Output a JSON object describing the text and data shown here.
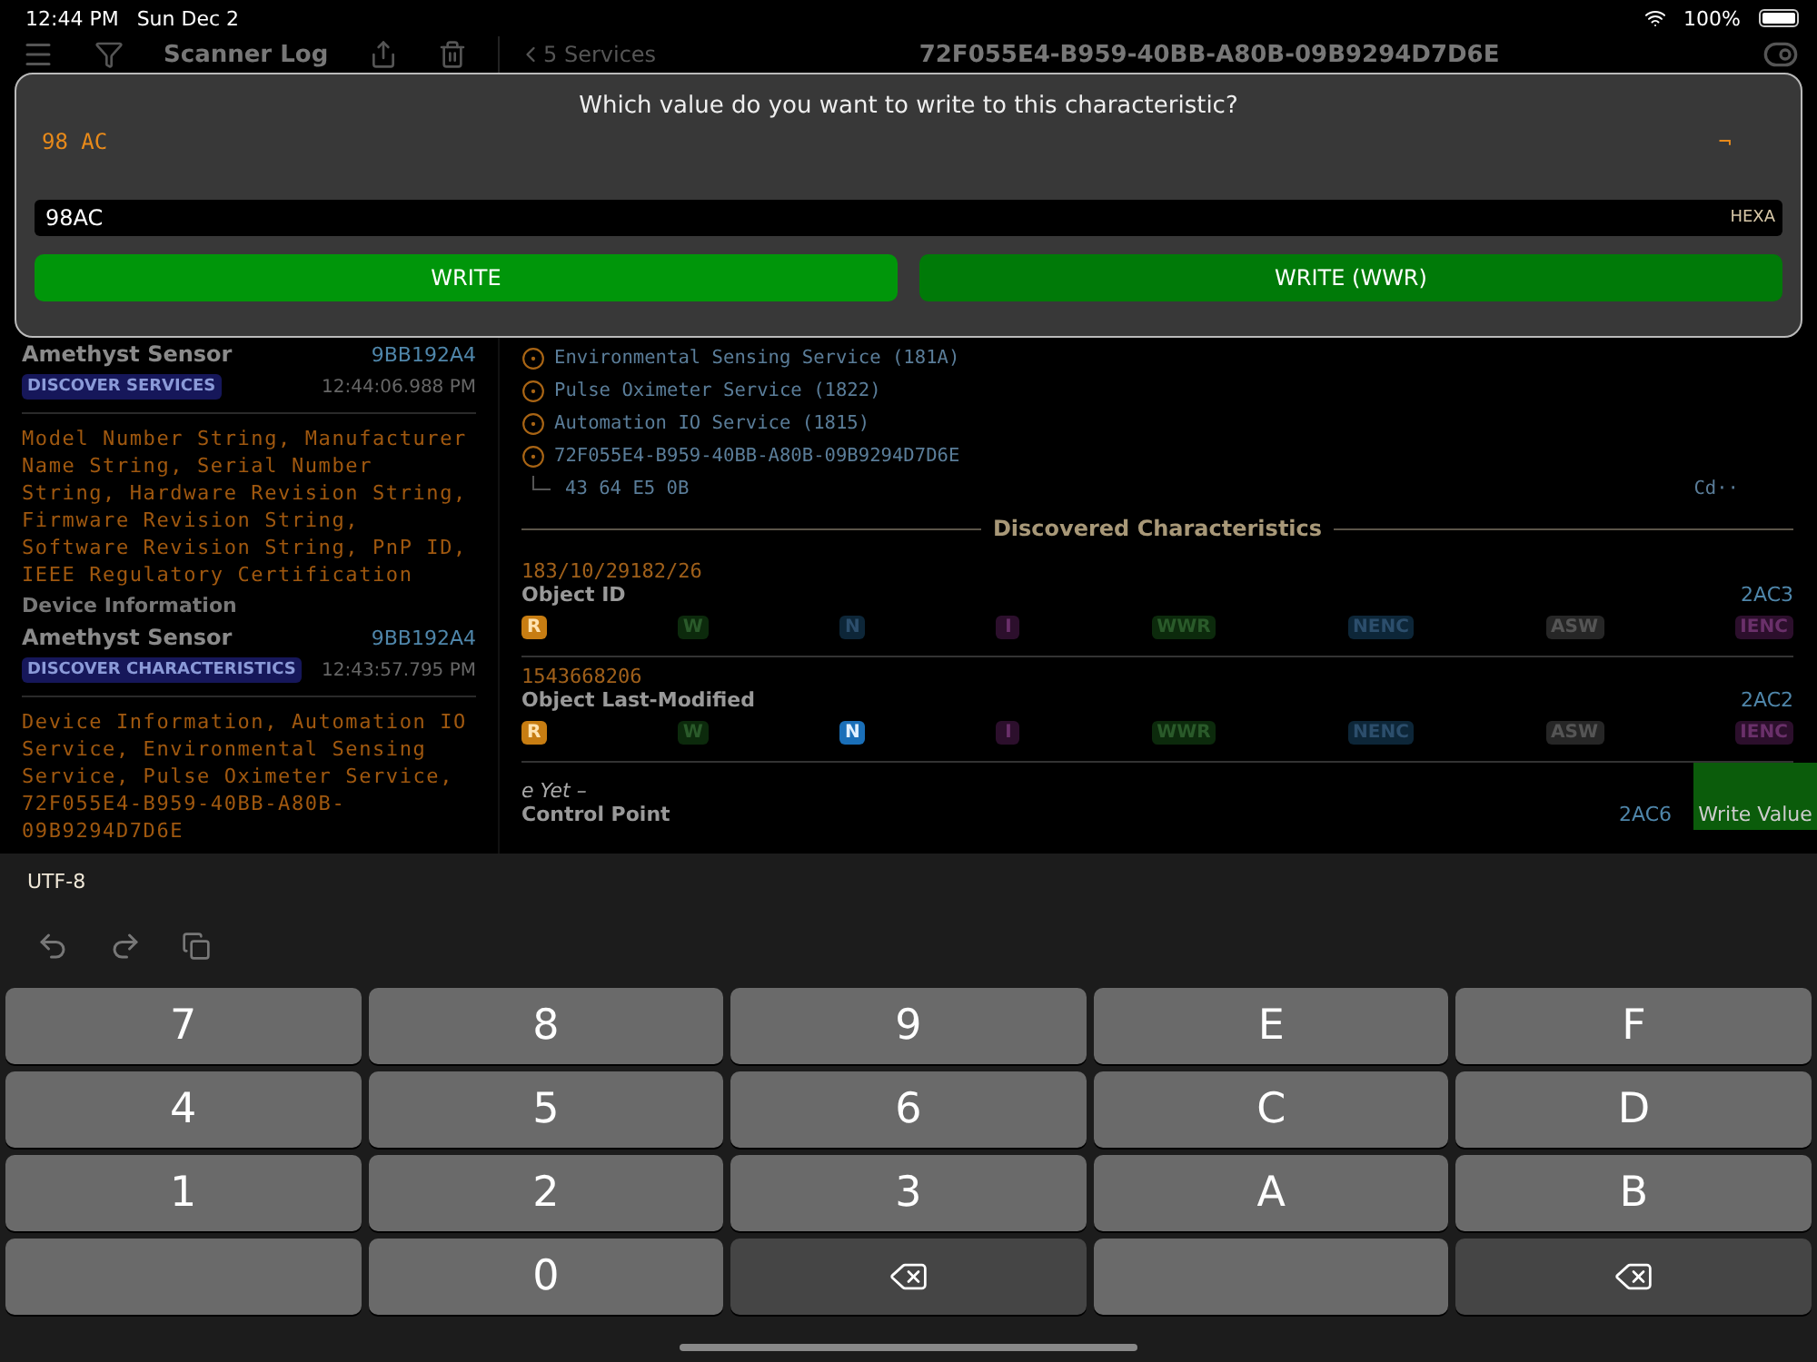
{
  "status_bar": {
    "time": "12:44 PM",
    "date": "Sun Dec 2",
    "battery": "100%"
  },
  "header": {
    "title": "Scanner Log",
    "back": "5 Services",
    "detail_title": "72F055E4-B959-40BB-A80B-09B9294D7D6E"
  },
  "dialog": {
    "prompt": "Which value do you want to write to this characteristic?",
    "preview": "98 AC",
    "preview_ascii": "¬",
    "input": {
      "value": "98AC",
      "format": "HEXA"
    },
    "buttons": [
      {
        "label": "WRITE",
        "kind": "primary"
      },
      {
        "label": "WRITE (WWR)",
        "kind": "secondary"
      }
    ]
  },
  "log": [
    {
      "device": "Amethyst Sensor",
      "id": "9BB192A4",
      "action": "DISCOVER SERVICES",
      "time": "12:44:06.988 PM",
      "details": "Model Number String, Manufacturer Name String, Serial Number String, Hardware Revision String, Firmware Revision String, Software Revision String, PnP ID, IEEE Regulatory Certification",
      "footer": "Device Information"
    },
    {
      "device": "Amethyst Sensor",
      "id": "9BB192A4",
      "action": "DISCOVER CHARACTERISTICS",
      "time": "12:43:57.795 PM",
      "details": "Device Information, Automation IO Service, Environmental Sensing Service, Pulse Oximeter Service, 72F055E4-B959-40BB-A80B-09B9294D7D6E"
    }
  ],
  "services": {
    "items": [
      "Environmental Sensing Service (181A)",
      "Pulse Oximeter Service (1822)",
      "Automation IO Service (1815)",
      "72F055E4-B959-40BB-A80B-09B9294D7D6E"
    ],
    "child": {
      "value": "43 64 E5 0B",
      "ascii": "Cd··"
    }
  },
  "characteristics": {
    "heading": "Discovered Characteristics",
    "items": [
      {
        "value": "183/10/29182/26",
        "name": "Object ID",
        "uuid": "2AC3",
        "properties": [
          {
            "label": "R",
            "kind": "read",
            "on": true
          },
          {
            "label": "W",
            "kind": "write",
            "on": false
          },
          {
            "label": "N",
            "kind": "notify",
            "on": false
          },
          {
            "label": "I",
            "kind": "indicate",
            "on": false
          },
          {
            "label": "WWR",
            "kind": "write",
            "on": false
          },
          {
            "label": "NENC",
            "kind": "notify",
            "on": false
          },
          {
            "label": "ASW",
            "kind": "signed",
            "on": false
          },
          {
            "label": "IENC",
            "kind": "indicate",
            "on": false
          }
        ]
      },
      {
        "value": "1543668206",
        "name": "Object Last-Modified",
        "uuid": "2AC2",
        "properties": [
          {
            "label": "R",
            "kind": "read",
            "on": true
          },
          {
            "label": "W",
            "kind": "write",
            "on": false
          },
          {
            "label": "N",
            "kind": "notify",
            "on": true
          },
          {
            "label": "I",
            "kind": "indicate",
            "on": false
          },
          {
            "label": "WWR",
            "kind": "write",
            "on": false
          },
          {
            "label": "NENC",
            "kind": "notify",
            "on": false
          },
          {
            "label": "ASW",
            "kind": "signed",
            "on": false
          },
          {
            "label": "IENC",
            "kind": "indicate",
            "on": false
          }
        ]
      }
    ],
    "partial": {
      "value": "e Yet –",
      "name": "Control Point",
      "uuid": "2AC6",
      "action": "Write Value"
    }
  },
  "keyboard": {
    "encoding": "UTF-8",
    "keys": [
      {
        "label": "7",
        "kind": "char"
      },
      {
        "label": "8",
        "kind": "char"
      },
      {
        "label": "9",
        "kind": "char"
      },
      {
        "label": "E",
        "kind": "char"
      },
      {
        "label": "F",
        "kind": "char"
      },
      {
        "label": "4",
        "kind": "char"
      },
      {
        "label": "5",
        "kind": "char"
      },
      {
        "label": "6",
        "kind": "char"
      },
      {
        "label": "C",
        "kind": "char"
      },
      {
        "label": "D",
        "kind": "char"
      },
      {
        "label": "1",
        "kind": "char"
      },
      {
        "label": "2",
        "kind": "char"
      },
      {
        "label": "3",
        "kind": "char"
      },
      {
        "label": "A",
        "kind": "char"
      },
      {
        "label": "B",
        "kind": "char"
      },
      {
        "kind": "blank"
      },
      {
        "label": "0",
        "kind": "char"
      },
      {
        "kind": "delete"
      },
      {
        "kind": "blank"
      },
      {
        "kind": "delete"
      }
    ]
  }
}
